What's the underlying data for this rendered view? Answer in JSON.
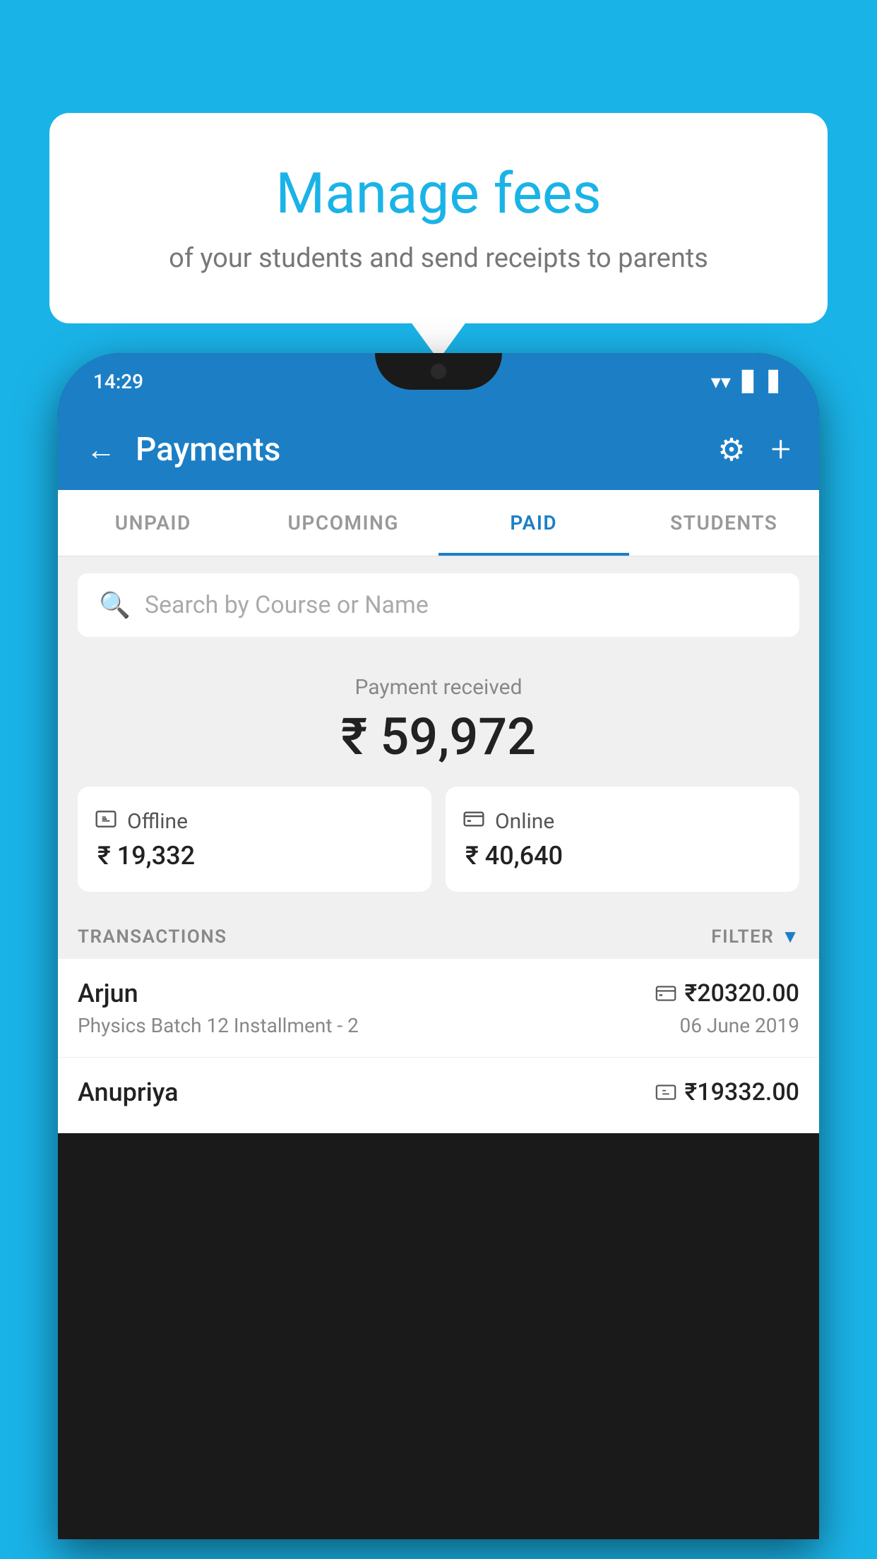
{
  "background_color": "#1ab3e8",
  "bubble": {
    "title": "Manage fees",
    "subtitle": "of your students and send receipts to parents"
  },
  "status_bar": {
    "time": "14:29",
    "icons": [
      "wifi",
      "signal",
      "battery"
    ]
  },
  "header": {
    "title": "Payments",
    "back_label": "←",
    "gear_label": "⚙",
    "plus_label": "+"
  },
  "tabs": [
    {
      "label": "UNPAID",
      "active": false
    },
    {
      "label": "UPCOMING",
      "active": false
    },
    {
      "label": "PAID",
      "active": true
    },
    {
      "label": "STUDENTS",
      "active": false
    }
  ],
  "search": {
    "placeholder": "Search by Course or Name"
  },
  "payment_summary": {
    "label": "Payment received",
    "total": "₹ 59,972",
    "offline": {
      "icon": "💳",
      "label": "Offline",
      "amount": "₹ 19,332"
    },
    "online": {
      "icon": "💳",
      "label": "Online",
      "amount": "₹ 40,640"
    }
  },
  "transactions": {
    "header_label": "TRANSACTIONS",
    "filter_label": "FILTER",
    "rows": [
      {
        "name": "Arjun",
        "course": "Physics Batch 12 Installment - 2",
        "amount": "₹20320.00",
        "date": "06 June 2019",
        "payment_type": "card"
      },
      {
        "name": "Anupriya",
        "course": "",
        "amount": "₹19332.00",
        "date": "",
        "payment_type": "cash"
      }
    ]
  }
}
